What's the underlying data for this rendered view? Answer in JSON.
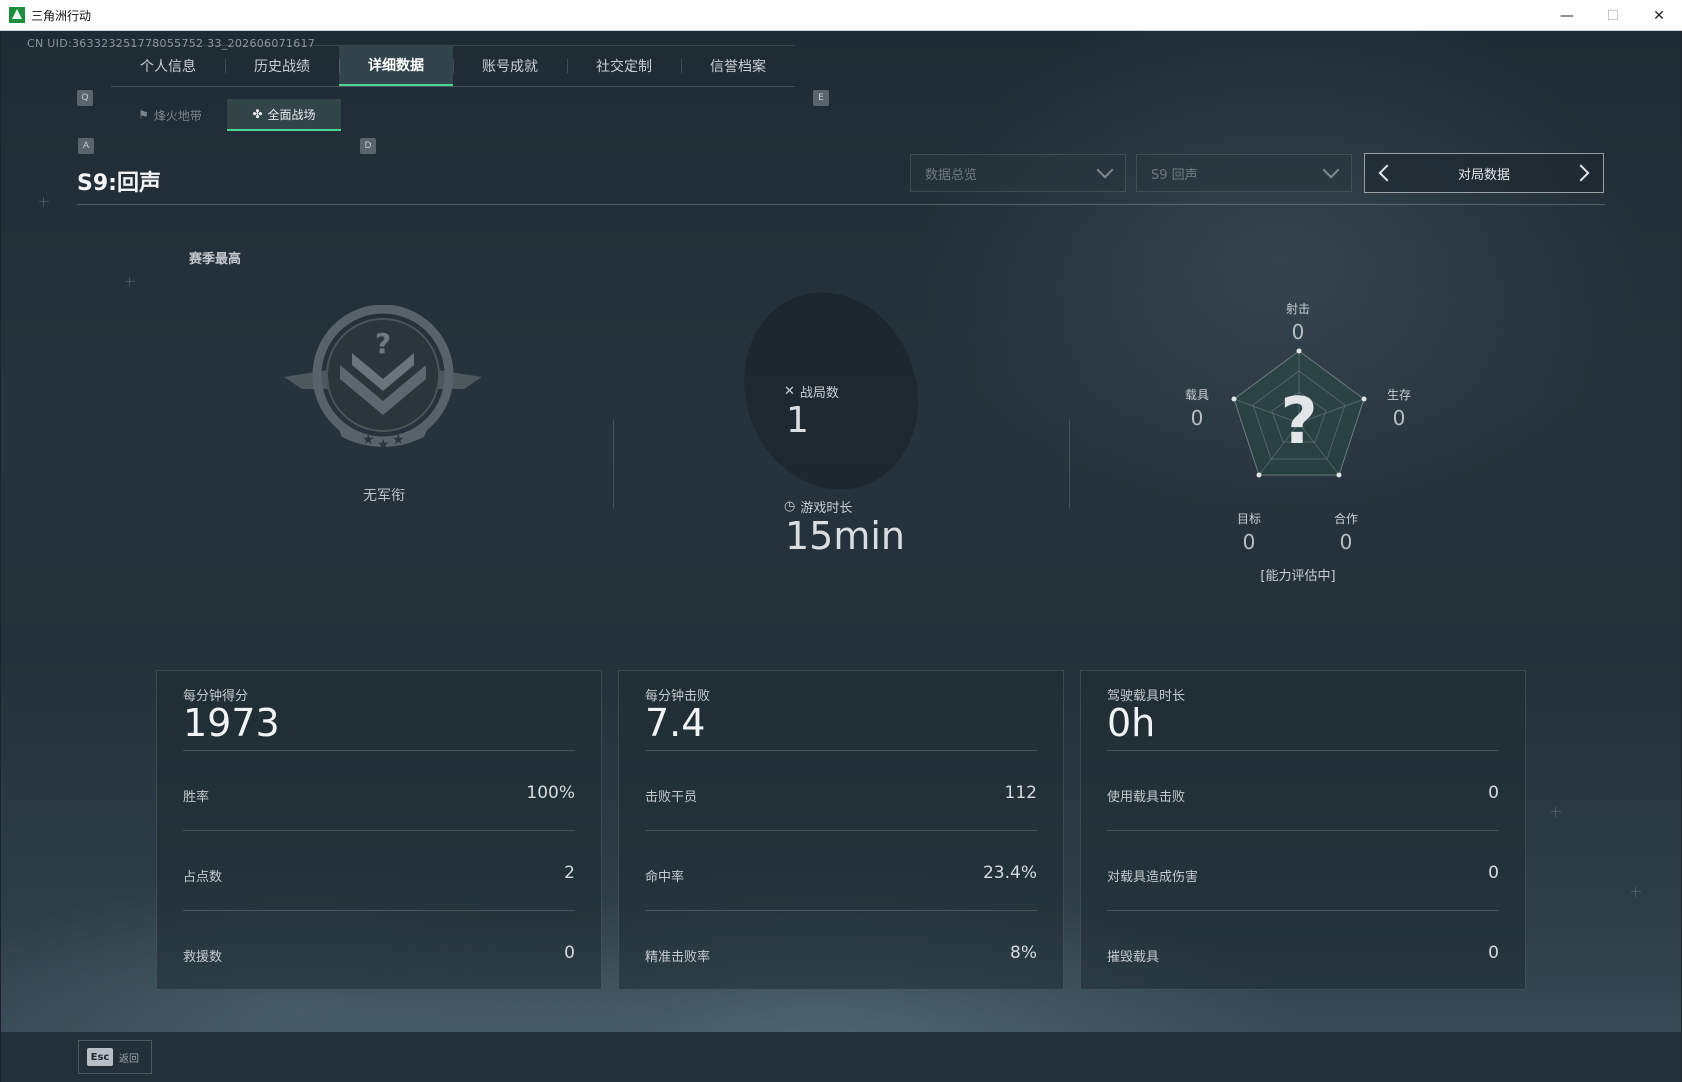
{
  "window": {
    "title": "三角洲行动"
  },
  "uid": "CN UID:3633232517780557523 3_20260607161 7",
  "uid_text": "CN UID:363323251778055752 33_202606071617",
  "key_hints": {
    "tab_prev": "Q",
    "tab_next": "E",
    "sub_prev": "A",
    "sub_next": "D"
  },
  "tabs": [
    {
      "label": "个人信息",
      "active": false
    },
    {
      "label": "历史战绩",
      "active": false
    },
    {
      "label": "详细数据",
      "active": true
    },
    {
      "label": "账号成就",
      "active": false
    },
    {
      "label": "社交定制",
      "active": false
    },
    {
      "label": "信誉档案",
      "active": false
    }
  ],
  "subtabs": [
    {
      "label": "烽火地带",
      "icon": "flag-icon",
      "active": false
    },
    {
      "label": "全面战场",
      "icon": "battlefield-icon",
      "active": true
    }
  ],
  "season_title": "S9:回声",
  "filters": {
    "overview": "数据总览",
    "season": "S9 回声",
    "pager_label": "对局数据"
  },
  "season_best": {
    "label": "赛季最高",
    "rank_name": "无军衔"
  },
  "middle_stats": {
    "matches_label": "战局数",
    "matches_value": "1",
    "playtime_label": "游戏时长",
    "playtime_value": "15min"
  },
  "radar": {
    "center_symbol": "?",
    "axes": [
      {
        "label": "射击",
        "value": "0"
      },
      {
        "label": "生存",
        "value": "0"
      },
      {
        "label": "合作",
        "value": "0"
      },
      {
        "label": "目标",
        "value": "0"
      },
      {
        "label": "载具",
        "value": "0"
      }
    ],
    "status": "[能力评估中]"
  },
  "panels": [
    {
      "title": "每分钟得分",
      "big": "1973",
      "rows": [
        {
          "label": "胜率",
          "value": "100%"
        },
        {
          "label": "占点数",
          "value": "2"
        },
        {
          "label": "救援数",
          "value": "0"
        }
      ]
    },
    {
      "title": "每分钟击败",
      "big": "7.4",
      "rows": [
        {
          "label": "击败干员",
          "value": "112"
        },
        {
          "label": "命中率",
          "value": "23.4%"
        },
        {
          "label": "精准击败率",
          "value": "8%"
        }
      ]
    },
    {
      "title": "驾驶载具时长",
      "big": "0h",
      "rows": [
        {
          "label": "使用载具击败",
          "value": "0"
        },
        {
          "label": "对载具造成伤害",
          "value": "0"
        },
        {
          "label": "摧毁载具",
          "value": "0"
        }
      ]
    }
  ],
  "footer": {
    "esc_key": "Esc",
    "back_label": "返回"
  },
  "colors": {
    "accent": "#4ed596",
    "background": "#1f2b34"
  }
}
